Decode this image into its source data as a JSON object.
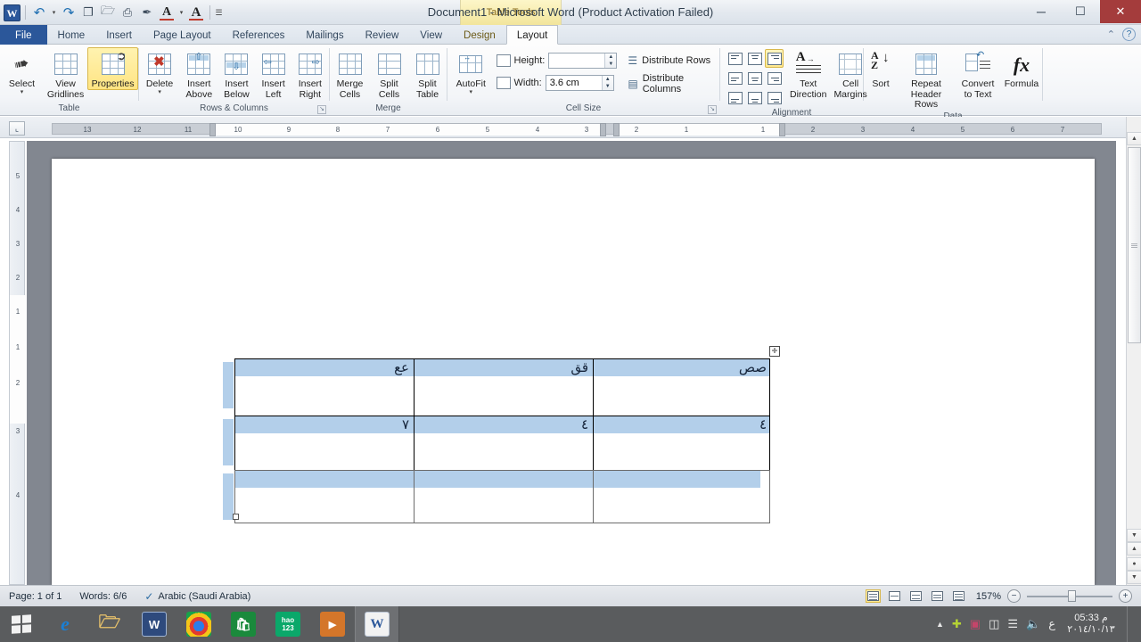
{
  "window": {
    "title": "Document1  -  Microsoft Word (Product Activation Failed)",
    "contextual_tool": "Table Tools",
    "minimize": "─",
    "maximize": "☐",
    "close": "✕"
  },
  "quick_access": {
    "items": [
      {
        "name": "word-logo",
        "glyph": "W"
      },
      {
        "name": "undo-icon",
        "glyph": "↶"
      },
      {
        "name": "undo-dropdown-icon",
        "glyph": "▾"
      },
      {
        "name": "redo-icon",
        "glyph": "↷"
      },
      {
        "name": "new-document-icon",
        "glyph": "❐"
      },
      {
        "name": "open-icon",
        "glyph": "🗁"
      },
      {
        "name": "print-icon",
        "glyph": "⎙"
      },
      {
        "name": "format-painter-icon",
        "glyph": "✒"
      },
      {
        "name": "font-color-icon",
        "glyph": "A"
      },
      {
        "name": "font-color-dropdown-icon",
        "glyph": "▾"
      },
      {
        "name": "grow-font-icon",
        "glyph": "A"
      },
      {
        "name": "customize-qat-icon",
        "glyph": "☰"
      }
    ]
  },
  "ribbon": {
    "tabs": [
      {
        "label": "File",
        "type": "file"
      },
      {
        "label": "Home",
        "type": "normal"
      },
      {
        "label": "Insert",
        "type": "normal"
      },
      {
        "label": "Page Layout",
        "type": "normal"
      },
      {
        "label": "References",
        "type": "normal"
      },
      {
        "label": "Mailings",
        "type": "normal"
      },
      {
        "label": "Review",
        "type": "normal"
      },
      {
        "label": "View",
        "type": "normal"
      },
      {
        "label": "Design",
        "type": "context"
      },
      {
        "label": "Layout",
        "type": "context-active"
      }
    ],
    "help_icon": "?",
    "collapse_icon": "⌃",
    "groups": {
      "table": {
        "label": "Table",
        "buttons": [
          {
            "label_top": "Select",
            "label_bottom": "",
            "icon": "pointer-icon",
            "dropdown": true,
            "selected": false
          },
          {
            "label_top": "View",
            "label_bottom": "Gridlines",
            "icon": "gridlines-icon",
            "dropdown": false,
            "selected": false
          },
          {
            "label_top": "Properties",
            "label_bottom": "",
            "icon": "table-properties-icon",
            "dropdown": false,
            "selected": true
          }
        ]
      },
      "rows_columns": {
        "label": "Rows & Columns",
        "buttons": [
          {
            "label_top": "Delete",
            "label_bottom": "",
            "icon": "delete-table-icon",
            "dropdown": true
          },
          {
            "label_top": "Insert",
            "label_bottom": "Above",
            "icon": "insert-above-icon",
            "dropdown": false
          },
          {
            "label_top": "Insert",
            "label_bottom": "Below",
            "icon": "insert-below-icon",
            "dropdown": false
          },
          {
            "label_top": "Insert",
            "label_bottom": "Left",
            "icon": "insert-left-icon",
            "dropdown": false
          },
          {
            "label_top": "Insert",
            "label_bottom": "Right",
            "icon": "insert-right-icon",
            "dropdown": false
          }
        ],
        "dialog_launcher": "↘"
      },
      "merge": {
        "label": "Merge",
        "buttons": [
          {
            "label_top": "Merge",
            "label_bottom": "Cells",
            "icon": "merge-cells-icon"
          },
          {
            "label_top": "Split",
            "label_bottom": "Cells",
            "icon": "split-cells-icon"
          },
          {
            "label_top": "Split",
            "label_bottom": "Table",
            "icon": "split-table-icon"
          }
        ]
      },
      "cell_size": {
        "label": "Cell Size",
        "autofit": {
          "label": "AutoFit",
          "icon": "autofit-icon",
          "dropdown": true
        },
        "height_label": "Height:",
        "height_value": "",
        "width_label": "Width:",
        "width_value": "3.6 cm",
        "distribute_rows": "Distribute Rows",
        "distribute_columns": "Distribute Columns",
        "dialog_launcher": "↘"
      },
      "alignment": {
        "label": "Alignment",
        "cells": [
          {
            "name": "align-top-left",
            "selected": false
          },
          {
            "name": "align-top-center",
            "selected": false
          },
          {
            "name": "align-top-right",
            "selected": true
          },
          {
            "name": "align-center-left",
            "selected": false
          },
          {
            "name": "align-center",
            "selected": false
          },
          {
            "name": "align-center-right",
            "selected": false
          },
          {
            "name": "align-bottom-left",
            "selected": false
          },
          {
            "name": "align-bottom-center",
            "selected": false
          },
          {
            "name": "align-bottom-right",
            "selected": false
          }
        ],
        "text_direction": {
          "label_top": "Text",
          "label_bottom": "Direction",
          "icon": "text-direction-icon"
        },
        "cell_margins": {
          "label_top": "Cell",
          "label_bottom": "Margins",
          "icon": "cell-margins-icon"
        }
      },
      "data": {
        "label": "Data",
        "buttons": [
          {
            "label_top": "Sort",
            "label_bottom": "",
            "icon": "sort-az-icon"
          },
          {
            "label_top": "Repeat",
            "label_bottom": "Header Rows",
            "icon": "repeat-header-rows-icon"
          },
          {
            "label_top": "Convert",
            "label_bottom": "to Text",
            "icon": "convert-to-text-icon"
          },
          {
            "label_top": "Formula",
            "label_bottom": "",
            "icon": "formula-icon"
          }
        ]
      }
    }
  },
  "ruler": {
    "corner_button": "⌞",
    "horizontal_ticks": [
      "13",
      "12",
      "11",
      "10",
      "9",
      "8",
      "7",
      "6",
      "5",
      "4",
      "3",
      "2",
      "1",
      "1",
      "2",
      "3",
      "4",
      "5",
      "6",
      "7"
    ],
    "vertical_ticks": [
      "5",
      "4",
      "3",
      "2",
      "1",
      "1",
      "2",
      "3",
      "4"
    ]
  },
  "document": {
    "table": {
      "rows": [
        {
          "cells": [
            "صص",
            "قق",
            "عع"
          ],
          "highlighted": true
        },
        {
          "cells": [
            "٤",
            "٤",
            "٧"
          ],
          "highlighted": true
        },
        {
          "cells": [
            "",
            "",
            ""
          ],
          "highlighted": true
        }
      ],
      "move_handle_icon": "✛",
      "resize_handle_icon": ""
    }
  },
  "status_bar": {
    "page": "Page: 1 of 1",
    "words": "Words: 6/6",
    "proofing_icon": "spell-check-icon",
    "language": "Arabic (Saudi Arabia)",
    "view_buttons": [
      {
        "name": "print-layout-view",
        "selected": true
      },
      {
        "name": "full-screen-reading-view",
        "selected": false
      },
      {
        "name": "web-layout-view",
        "selected": false
      },
      {
        "name": "outline-view",
        "selected": false
      },
      {
        "name": "draft-view",
        "selected": false
      }
    ],
    "zoom_level": "157%",
    "zoom_out": "−",
    "zoom_in": "+"
  },
  "taskbar": {
    "start_label": "Start",
    "apps": [
      {
        "name": "internet-explorer",
        "glyph": "e",
        "color": "#1a7fd4",
        "bg": "transparent",
        "active": false
      },
      {
        "name": "file-explorer",
        "glyph": "🗁",
        "color": "#e8c26b",
        "bg": "transparent",
        "active": false
      },
      {
        "name": "wow-launcher",
        "glyph": "W",
        "color": "#ffffff",
        "bg": "#2e4a7d",
        "active": false
      },
      {
        "name": "google-chrome",
        "glyph": "◉",
        "color": "#ffffff",
        "bg": "transparent",
        "active": false
      },
      {
        "name": "windows-store",
        "glyph": "🛍",
        "color": "#ffffff",
        "bg": "#1a8a3c",
        "active": false
      },
      {
        "name": "hao123",
        "glyph": "hao\n123",
        "color": "#ffffff",
        "bg": "#0aa86a",
        "active": false
      },
      {
        "name": "media-player",
        "glyph": "▶",
        "color": "#ffffff",
        "bg": "#d4762a",
        "active": false
      },
      {
        "name": "microsoft-word",
        "glyph": "W",
        "color": "#ffffff",
        "bg": "#2b579a",
        "active": true
      }
    ],
    "tray": {
      "show_hidden_icon": "▲",
      "icons": [
        "shield-icon",
        "antivirus-icon",
        "battery-icon",
        "network-icon",
        "volume-icon"
      ],
      "language": "ع",
      "time": "05:33 م",
      "date": "٢٠١٤/١٠/١٣"
    }
  }
}
